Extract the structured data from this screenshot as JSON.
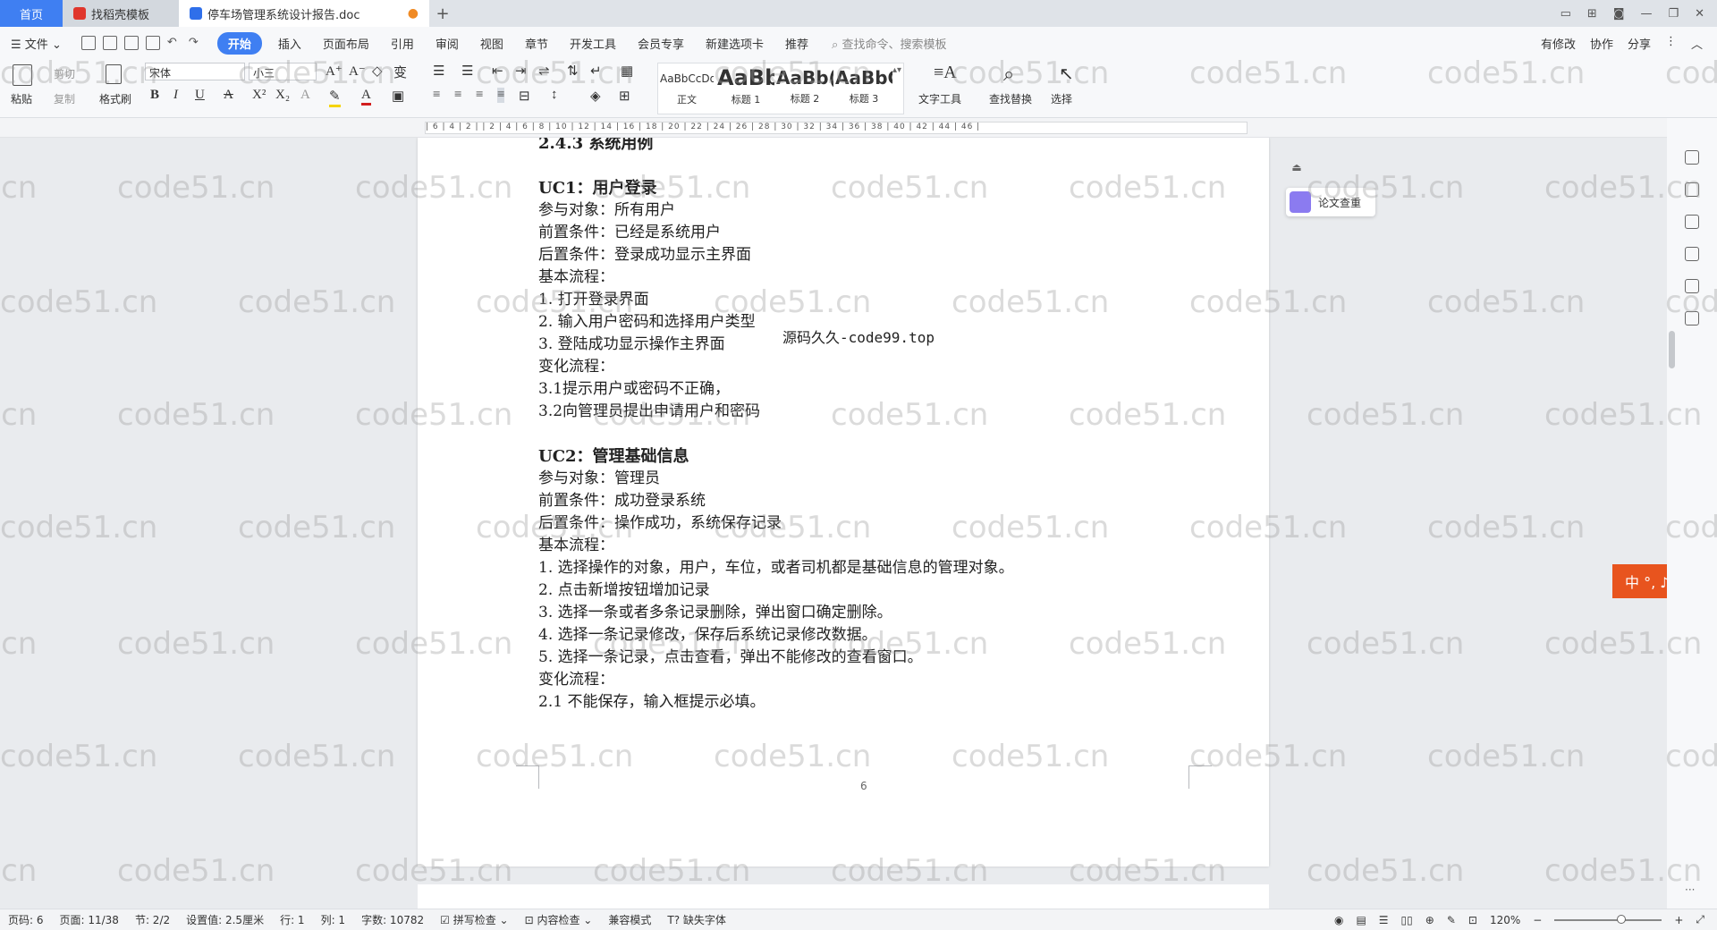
{
  "tabs": {
    "home": "首页",
    "template": "找稻壳模板",
    "doc": "停车场管理系统设计报告.doc"
  },
  "menu": {
    "file": "文件",
    "items": [
      "开始",
      "插入",
      "页面布局",
      "引用",
      "审阅",
      "视图",
      "章节",
      "开发工具",
      "会员专享",
      "新建选项卡",
      "推荐"
    ],
    "search_placeholder": "查找命令、搜索模板",
    "right": [
      "有修改",
      "协作",
      "分享"
    ]
  },
  "ribbon": {
    "paste": "粘贴",
    "cut": "剪切",
    "copy": "复制",
    "format_painter": "格式刷",
    "font_name": "宋体",
    "font_size": "小三",
    "styles": [
      {
        "sample": "AaBbCcDd",
        "label": "正文"
      },
      {
        "sample": "AaBb",
        "label": "标题 1"
      },
      {
        "sample": "AaBb(",
        "label": "标题 2"
      },
      {
        "sample": "AaBbC",
        "label": "标题 3"
      }
    ],
    "text_tools": "文字工具",
    "find_replace": "查找替换",
    "select": "选择"
  },
  "ruler": {
    "ticks": "| 6 | 4 | 2 | | 2 | 4 | 6 | 8 | 10 | 12 | 14 | 16 | 18 | 20 | 22 | 24 | 26 | 28 | 30 | 32 | 34 | 36 | 38 | 40 | 42 | 44 | 46 |"
  },
  "document": {
    "section_title": "2.4.3 系统用例",
    "uc1_title": "UC1：用户登录",
    "uc1_lines": [
      "参与对象：所有用户",
      "前置条件：已经是系统用户",
      "后置条件：登录成功显示主界面",
      "基本流程：",
      "1. 打开登录界面",
      "2. 输入用户密码和选择用户类型",
      "3. 登陆成功显示操作主界面",
      "变化流程：",
      "3.1提示用户或密码不正确，",
      "3.2向管理员提出申请用户和密码"
    ],
    "uc2_title": "UC2：管理基础信息",
    "uc2_lines": [
      "参与对象：管理员",
      "前置条件：成功登录系统",
      "后置条件：操作成功，系统保存记录",
      "基本流程：",
      "1. 选择操作的对象，用户，车位，或者司机都是基础信息的管理对象。",
      "2. 点击新增按钮增加记录",
      "3. 选择一条或者多条记录删除，弹出窗口确定删除。",
      "4. 选择一条记录修改，保存后系统记录修改数据。",
      "5. 选择一条记录，点击查看，弹出不能修改的查看窗口。",
      "变化流程：",
      "2.1 不能保存，输入框提示必填。"
    ],
    "overlay_source": "源码久久-code99.top",
    "page_number": "6"
  },
  "floating": {
    "check_label": "论文查重",
    "ime": "中 °, ♪"
  },
  "watermark": "code51.cn",
  "status": {
    "page": "页码: 6",
    "pages": "页面: 11/38",
    "section": "节: 2/2",
    "setting": "设置值: 2.5厘米",
    "row": "行: 1",
    "col": "列: 1",
    "words": "字数: 10782",
    "spell": "拼写检查",
    "content_check": "内容检查",
    "compat": "兼容模式",
    "missing_font": "缺失字体",
    "zoom": "120%"
  }
}
